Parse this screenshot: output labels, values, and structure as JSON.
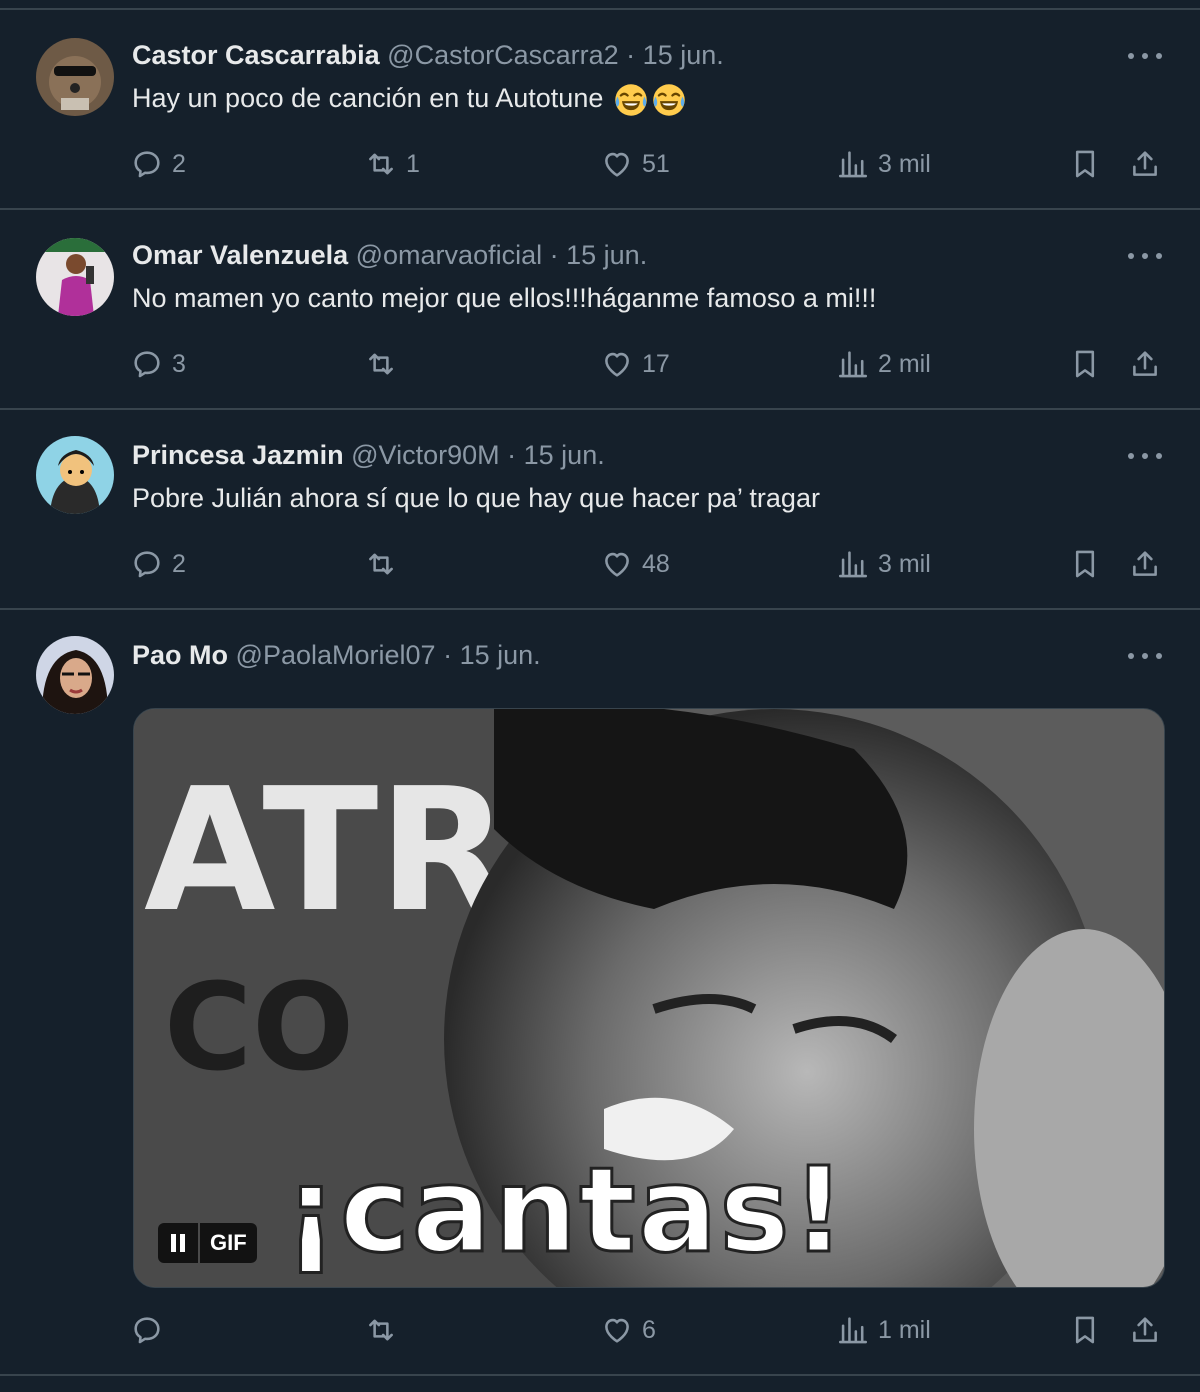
{
  "colors": {
    "background": "#15202b",
    "divider": "#38444d",
    "muted": "#8b98a5",
    "text": "#e7e9ea"
  },
  "tweets": [
    {
      "name": "Castor Cascarrabia",
      "handle": "@CastorCascarra2",
      "separator": "·",
      "date": "15 jun.",
      "text": "Hay un poco de canción en tu Autotune",
      "emoji": [
        "face-with-tears-of-joy",
        "face-with-tears-of-joy"
      ],
      "stats": {
        "replies": "2",
        "retweets": "1",
        "likes": "51",
        "views": "3 mil"
      }
    },
    {
      "name": "Omar Valenzuela",
      "handle": "@omarvaoficial",
      "separator": "·",
      "date": "15 jun.",
      "text": "No mamen yo canto mejor que ellos!!!háganme famoso a mi!!!",
      "stats": {
        "replies": "3",
        "retweets": "",
        "likes": "17",
        "views": "2 mil"
      }
    },
    {
      "name": "Princesa Jazmin",
      "handle": "@Victor90M",
      "separator": "·",
      "date": "15 jun.",
      "text": "Pobre Julián ahora sí que lo que hay que hacer pa’ tragar",
      "stats": {
        "replies": "2",
        "retweets": "",
        "likes": "48",
        "views": "3 mil"
      }
    },
    {
      "name": "Pao Mo",
      "handle": "@PaolaMoriel07",
      "separator": "·",
      "date": "15 jun.",
      "media": {
        "badge": "GIF",
        "caption": "¡cantas!",
        "bg_text_1": "ATR",
        "bg_text_2": "CO"
      },
      "stats": {
        "replies": "",
        "retweets": "",
        "likes": "6",
        "views": "1 mil"
      }
    }
  ],
  "icons": {
    "reply": "reply-icon",
    "retweet": "retweet-icon",
    "like": "heart-icon",
    "views": "views-icon",
    "bookmark": "bookmark-icon",
    "share": "share-icon",
    "more": "more-icon"
  }
}
